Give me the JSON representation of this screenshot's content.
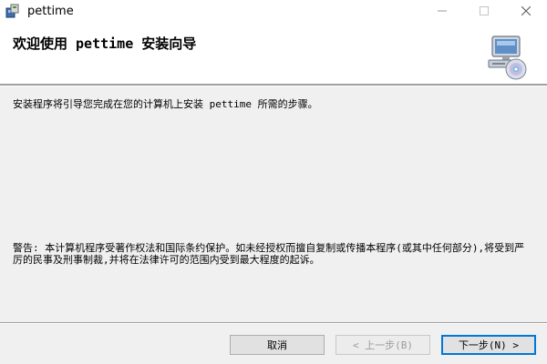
{
  "window": {
    "title": "pettime",
    "app_icon": "installer-icon",
    "controls": {
      "minimize_icon": "minimize-icon",
      "maximize_icon": "maximize-icon",
      "close_icon": "close-icon"
    }
  },
  "header": {
    "title": "欢迎使用 pettime 安装向导",
    "graphic_icon": "computer-cd-icon"
  },
  "body": {
    "intro": "安装程序将引导您完成在您的计算机上安装 pettime 所需的步骤。",
    "warning": "警告: 本计算机程序受著作权法和国际条约保护。如未经授权而擅自复制或传播本程序(或其中任何部分),将受到严厉的民事及刑事制裁,并将在法律许可的范围内受到最大程度的起诉。"
  },
  "buttons": {
    "cancel": "取消",
    "back": "< 上一步(B)",
    "next": "下一步(N) >"
  },
  "colors": {
    "window_bg": "#f0f0f0",
    "header_bg": "#ffffff",
    "focus_border": "#0078d7",
    "disabled_text": "#9a9a9a"
  }
}
